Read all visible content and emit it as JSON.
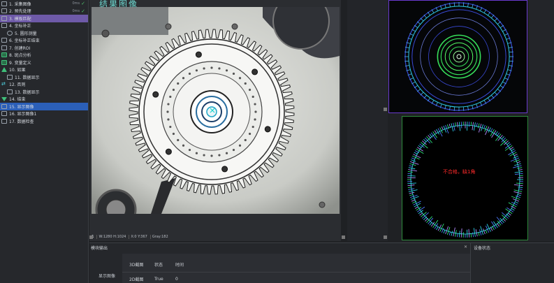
{
  "tree": [
    {
      "label": "1. 采集图像",
      "status": "0ms",
      "check": "✓",
      "icon": "camera-icon",
      "state": "normal",
      "indent": 0
    },
    {
      "label": "2. 预先处理",
      "status": "0ms",
      "check": "✓",
      "icon": "preprocess-icon",
      "state": "normal",
      "indent": 0
    },
    {
      "label": "3. 模板匹配",
      "status": "",
      "check": "",
      "icon": "template-match-icon",
      "state": "purple",
      "indent": 0
    },
    {
      "label": "4. 坐标补正",
      "status": "",
      "check": "",
      "icon": "coordinate-icon",
      "state": "normal",
      "indent": 0
    },
    {
      "label": "5. 圆形测量",
      "status": "",
      "check": "",
      "icon": "circle-measure-icon",
      "state": "normal",
      "indent": 1
    },
    {
      "label": "6. 坐标补正结束",
      "status": "",
      "check": "",
      "icon": "coordinate-end-icon",
      "state": "normal",
      "indent": 0
    },
    {
      "label": "7. 创建ROI",
      "status": "",
      "check": "",
      "icon": "roi-icon",
      "state": "normal",
      "indent": 0
    },
    {
      "label": "8. 斑点分析",
      "status": "",
      "check": "",
      "icon": "blob-icon",
      "state": "normal",
      "indent": 0
    },
    {
      "label": "9. 变量定义",
      "status": "",
      "check": "",
      "icon": "variable-icon",
      "state": "normal",
      "indent": 0
    },
    {
      "label": "10. 如果",
      "status": "",
      "check": "",
      "icon": "if-icon",
      "state": "normal",
      "indent": 0
    },
    {
      "label": "11. 数据显示",
      "status": "",
      "check": "",
      "icon": "data-display-icon",
      "state": "normal",
      "indent": 1
    },
    {
      "label": "12. 否则",
      "status": "",
      "check": "",
      "icon": "else-icon",
      "state": "normal",
      "indent": 0
    },
    {
      "label": "13. 数据显示",
      "status": "",
      "check": "",
      "icon": "data-display-icon",
      "state": "normal",
      "indent": 1
    },
    {
      "label": "14. 结束",
      "status": "",
      "check": "",
      "icon": "end-icon",
      "state": "normal",
      "indent": 0
    },
    {
      "label": "15. 显示图像",
      "status": "",
      "check": "",
      "icon": "show-image-icon",
      "state": "blue",
      "indent": 0
    },
    {
      "label": "16. 显示图像1",
      "status": "",
      "check": "",
      "icon": "show-image-icon",
      "state": "normal",
      "indent": 0
    },
    {
      "label": "17. 数据检查",
      "status": "",
      "check": "",
      "icon": "data-check-icon",
      "state": "normal",
      "indent": 0
    }
  ],
  "main": {
    "title": "结果图像",
    "status": [
      "1",
      "W:1280 H:1024",
      "X:0 Y:367",
      "Gray:182"
    ]
  },
  "result": {
    "text": "不合格，缺1角",
    "color": "#ff2a2a"
  },
  "output": {
    "title": "模块输出",
    "close": "✕",
    "row_label": "显示图像",
    "header": [
      "3D截图",
      "状态",
      "时间"
    ],
    "row": [
      "2D截图",
      "True",
      "0"
    ]
  },
  "device": {
    "title": "设备状态"
  }
}
